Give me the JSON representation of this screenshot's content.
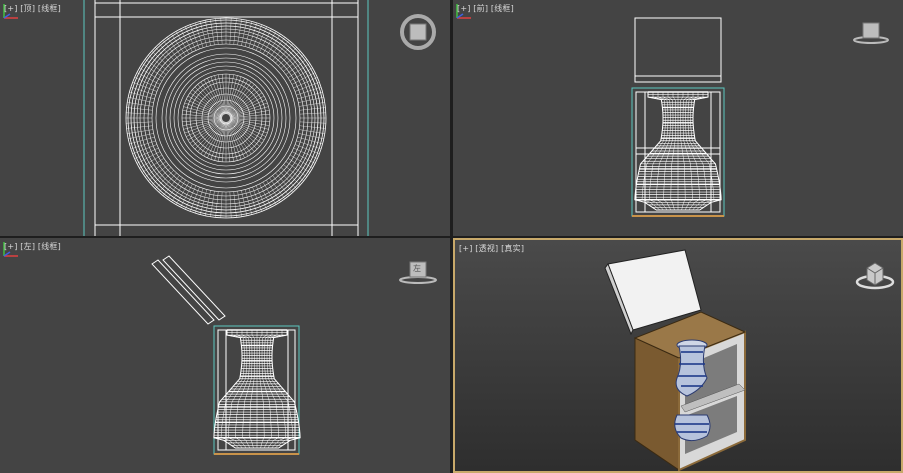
{
  "viewports": {
    "top": {
      "plus": "[+]",
      "view": "[顶]",
      "mode": "[线框]"
    },
    "front": {
      "plus": "[+]",
      "view": "[前]",
      "mode": "[线框]"
    },
    "left": {
      "plus": "[+]",
      "view": "[左]",
      "mode": "[线框]",
      "cube_label": "左"
    },
    "perspective": {
      "plus": "[+]",
      "view": "[透视]",
      "mode": "[真实]"
    }
  },
  "colors": {
    "viewport_bg": "#444444",
    "persp_bg": "#3c3c3c",
    "wire": "#ffffff",
    "frame": "#5cc8c0",
    "active_border": "#c8a96a",
    "wood": "#8b6a3a",
    "axis_x": "#e04040",
    "axis_y": "#40c040",
    "axis_z": "#4060e0"
  }
}
